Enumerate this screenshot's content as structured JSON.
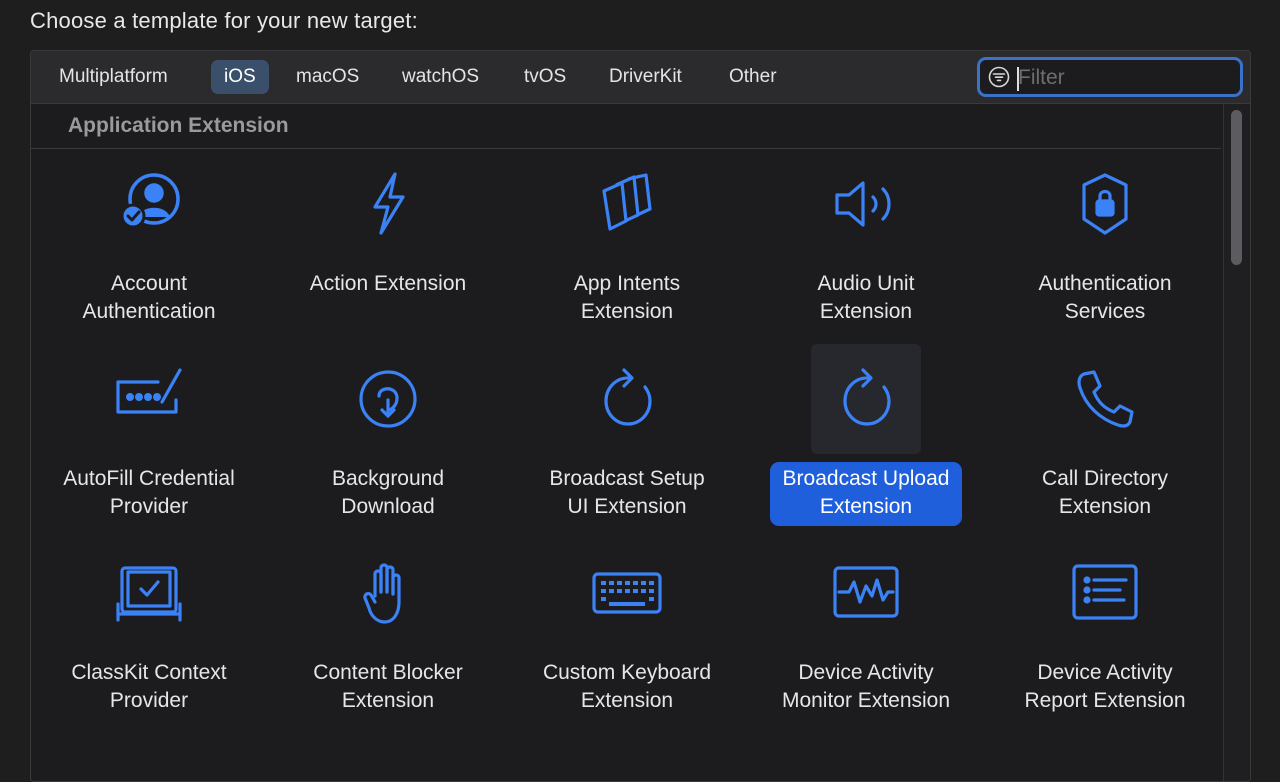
{
  "prompt": "Choose a template for your new target:",
  "tabs": [
    {
      "label": "Multiplatform"
    },
    {
      "label": "iOS"
    },
    {
      "label": "macOS"
    },
    {
      "label": "watchOS"
    },
    {
      "label": "tvOS"
    },
    {
      "label": "DriverKit"
    },
    {
      "label": "Other"
    }
  ],
  "active_tab": "iOS",
  "filter": {
    "placeholder": "Filter",
    "value": ""
  },
  "section": {
    "title": "Application Extension"
  },
  "accent_color": "#3b82f6",
  "selection_color": "#1f5fdc",
  "templates": [
    {
      "label": "Account\nAuthentication",
      "icon": "person-checkmark-icon"
    },
    {
      "label": "Action Extension",
      "icon": "bolt-icon"
    },
    {
      "label": "App Intents\nExtension",
      "icon": "app-intents-icon"
    },
    {
      "label": "Audio Unit\nExtension",
      "icon": "speaker-wave-icon"
    },
    {
      "label": "Authentication\nServices",
      "icon": "lock-shield-icon"
    },
    {
      "label": "AutoFill Credential\nProvider",
      "icon": "password-field-icon"
    },
    {
      "label": "Background\nDownload",
      "icon": "download-circle-icon"
    },
    {
      "label": "Broadcast Setup\nUI Extension",
      "icon": "refresh-arrow-icon"
    },
    {
      "label": "Broadcast Upload\nExtension",
      "icon": "refresh-arrow-icon",
      "selected": true
    },
    {
      "label": "Call Directory\nExtension",
      "icon": "phone-icon"
    },
    {
      "label": "ClassKit Context\nProvider",
      "icon": "checkbox-frame-icon"
    },
    {
      "label": "Content Blocker\nExtension",
      "icon": "hand-raised-icon"
    },
    {
      "label": "Custom Keyboard\nExtension",
      "icon": "keyboard-icon"
    },
    {
      "label": "Device Activity\nMonitor Extension",
      "icon": "waveform-frame-icon"
    },
    {
      "label": "Device Activity\nReport Extension",
      "icon": "list-frame-icon"
    }
  ]
}
